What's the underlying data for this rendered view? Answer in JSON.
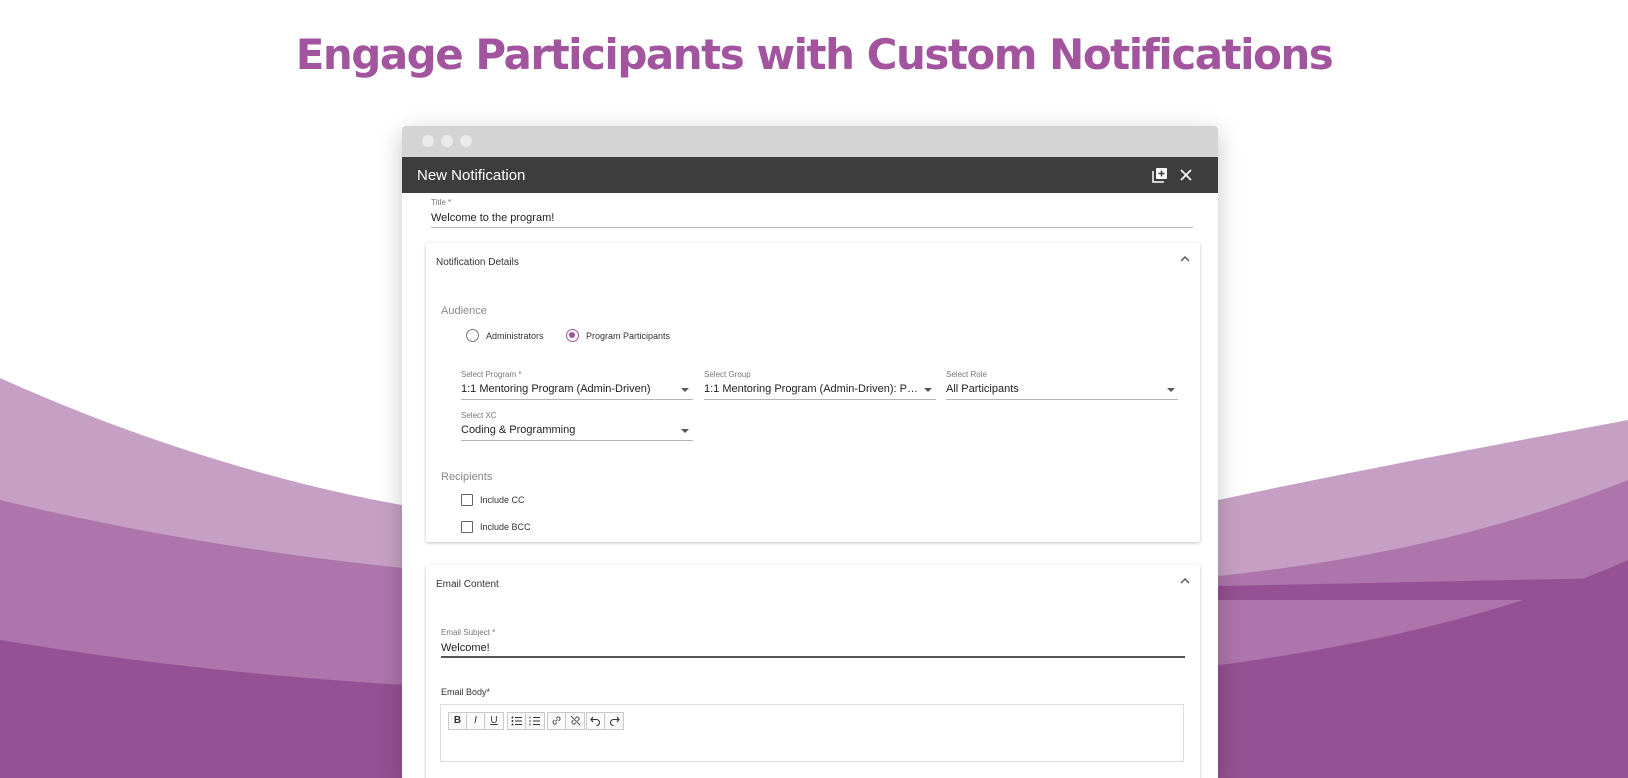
{
  "page": {
    "headline": "Engage Participants with Custom Notifications",
    "colors": {
      "brand_purple": "#a2559e",
      "wave_dark": "#955193",
      "wave_mid": "#ad75ac",
      "wave_light": "#c5a0c4",
      "header_dark": "#3d3d3d"
    }
  },
  "dialog": {
    "title": "New Notification",
    "icons": {
      "add": "library-add-icon",
      "close": "close-icon"
    },
    "title_field": {
      "label": "Title *",
      "value": "Welcome to the program!"
    },
    "notification_details": {
      "heading": "Notification Details",
      "audience": {
        "label": "Audience",
        "options": [
          {
            "label": "Administrators",
            "checked": false
          },
          {
            "label": "Program Participants",
            "checked": true
          }
        ]
      },
      "selects": {
        "program": {
          "label": "Select Program *",
          "value": "1:1 Mentoring Program (Admin-Driven)"
        },
        "group": {
          "label": "Select Group",
          "value": "1:1 Mentoring Program (Admin-Driven): Program Participants"
        },
        "role": {
          "label": "Select Role",
          "value": "All Participants"
        },
        "xc": {
          "label": "Select XC",
          "value": "Coding & Programming"
        }
      },
      "recipients": {
        "label": "Recipients",
        "options": [
          {
            "label": "Include CC",
            "checked": false
          },
          {
            "label": "Include BCC",
            "checked": false
          }
        ]
      }
    },
    "email_content": {
      "heading": "Email Content",
      "subject": {
        "label": "Email Subject *",
        "value": "Welcome!"
      },
      "body_label": "Email Body*",
      "toolbar": {
        "bold": "B",
        "italic": "I",
        "underline": "U",
        "bullet_list": "bulleted-list-icon",
        "numbered_list": "numbered-list-icon",
        "link": "link-icon",
        "unlink": "unlink-icon",
        "undo": "undo-icon",
        "redo": "redo-icon"
      }
    }
  }
}
